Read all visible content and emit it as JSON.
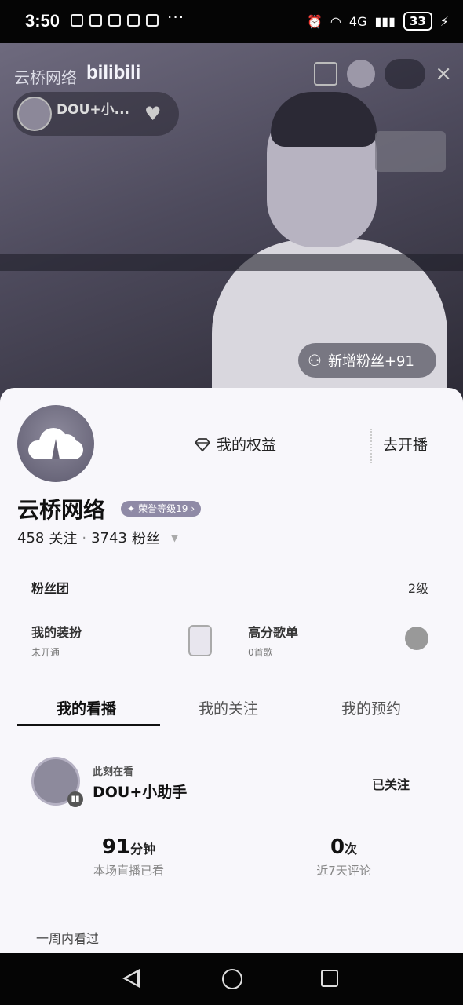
{
  "status_bar": {
    "time": "3:50",
    "extra": "···",
    "network": "4G",
    "battery": "33"
  },
  "video": {
    "watermark": "云桥网络",
    "watermark_brand": "bilibili",
    "host_name": "DOU+小...",
    "new_fans": "新增粉丝+91"
  },
  "profile": {
    "rights_label": "我的权益",
    "go_live_label": "去开播",
    "name": "云桥网络",
    "honor_badge": "荣誉等级19",
    "following_count": "458",
    "following_label": "关注",
    "fans_count": "3743",
    "fans_label": "粉丝"
  },
  "fanclub": {
    "label": "粉丝团",
    "level": "2级"
  },
  "items": [
    {
      "title": "我的装扮",
      "sub": "未开通"
    },
    {
      "title": "高分歌单",
      "sub": "0首歌"
    }
  ],
  "tabs": [
    {
      "label": "我的看播"
    },
    {
      "label": "我的关注"
    },
    {
      "label": "我的预约"
    }
  ],
  "watching": {
    "status": "此刻在看",
    "name": "DOU+小助手",
    "follow_state": "已关注"
  },
  "metrics": [
    {
      "value": "91",
      "unit": "分钟",
      "label": "本场直播已看"
    },
    {
      "value": "0",
      "unit": "次",
      "label": "近7天评论"
    }
  ],
  "week_section": "一周内看过"
}
